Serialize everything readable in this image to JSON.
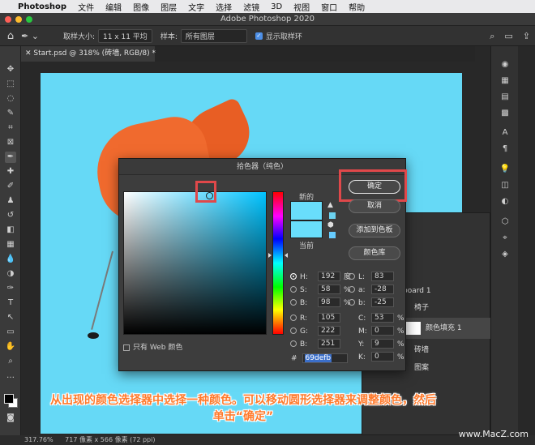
{
  "menubar": {
    "app_name": "Photoshop",
    "items": [
      "文件",
      "编辑",
      "图像",
      "图层",
      "文字",
      "选择",
      "滤镜",
      "3D",
      "视图",
      "窗口",
      "帮助"
    ]
  },
  "window": {
    "title": "Adobe Photoshop 2020"
  },
  "options": {
    "sample_size_label": "取样大小:",
    "sample_size_value": "11 x 11 平均",
    "sample_label": "样本:",
    "sample_value": "所有图层",
    "show_ring_label": "显示取样环"
  },
  "document": {
    "tab_title": "Start.psd @ 318% (砖墙, RGB/8) *"
  },
  "layers_panel": {
    "artboard_label": "board 1",
    "layers": [
      "椅子",
      "颜色填充 1",
      "砖墙",
      "图案"
    ]
  },
  "color_picker": {
    "title": "拾色器（纯色）",
    "new_label": "新的",
    "current_label": "当前",
    "ok_label": "确定",
    "cancel_label": "取消",
    "add_swatch_label": "添加到色板",
    "libraries_label": "颜色库",
    "web_only_label": "只有 Web 颜色",
    "hex_label": "#",
    "hex_value": "69defb",
    "hsb": [
      {
        "label": "H:",
        "value": "192",
        "unit": "度"
      },
      {
        "label": "S:",
        "value": "58",
        "unit": "%"
      },
      {
        "label": "B:",
        "value": "98",
        "unit": "%"
      }
    ],
    "rgb": [
      {
        "label": "R:",
        "value": "105"
      },
      {
        "label": "G:",
        "value": "222"
      },
      {
        "label": "B:",
        "value": "251"
      }
    ],
    "lab": [
      {
        "label": "L:",
        "value": "83"
      },
      {
        "label": "a:",
        "value": "-28"
      },
      {
        "label": "b:",
        "value": "-25"
      }
    ],
    "cmyk": [
      {
        "label": "C:",
        "value": "53",
        "unit": "%"
      },
      {
        "label": "M:",
        "value": "0",
        "unit": "%"
      },
      {
        "label": "Y:",
        "value": "9",
        "unit": "%"
      },
      {
        "label": "K:",
        "value": "0",
        "unit": "%"
      }
    ],
    "selected_color": "#69defb"
  },
  "caption": {
    "line1": "从出现的颜色选择器中选择一种颜色。可以移动圆形选择器来调整颜色，然后",
    "line2": "单击“确定”"
  },
  "status": {
    "zoom": "317.76%",
    "doc_info": "717 像素 x 566 像素 (72 ppi)"
  },
  "watermark": "www.MacZ.com",
  "colors": {
    "accent_highlight": "#e0484a",
    "caption": "#ff7a2c",
    "canvas_bg": "#66d9f6"
  }
}
